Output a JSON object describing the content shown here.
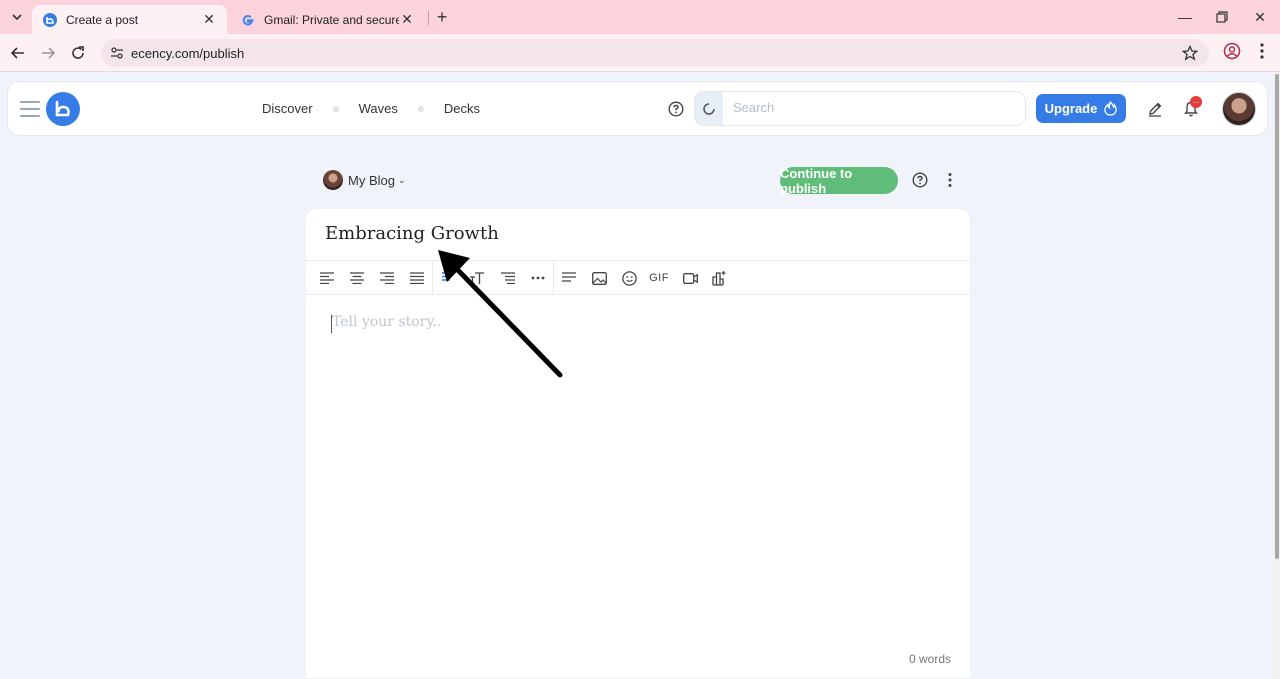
{
  "browser": {
    "tabs": [
      {
        "title": "Create a post",
        "active": true
      },
      {
        "title": "Gmail: Private and secure email",
        "active": false
      }
    ],
    "url": "ecency.com/publish"
  },
  "app_nav": {
    "links": [
      "Discover",
      "Waves",
      "Decks"
    ],
    "search_placeholder": "Search",
    "upgrade_label": "Upgrade",
    "notification_badge": "..."
  },
  "editor_header": {
    "blog_selector": "My Blog",
    "publish_label": "Continue to publish"
  },
  "editor": {
    "title": "Embracing Growth",
    "body_placeholder": "Tell your story..",
    "toolbar": [
      "align-left-icon",
      "align-center-icon",
      "align-right-icon",
      "align-justify-icon",
      "bold-icon",
      "text-size-icon",
      "list-icon",
      "more-icon",
      "paragraph-icon",
      "image-icon",
      "emoji-icon",
      "GIF",
      "video-icon",
      "chart-icon"
    ],
    "word_count": "0 words"
  },
  "colors": {
    "tab_strip": "#fbd3dc",
    "brand_blue": "#357ce6",
    "publish_green": "#5fbd79",
    "page_bg": "#f0f4fa"
  }
}
